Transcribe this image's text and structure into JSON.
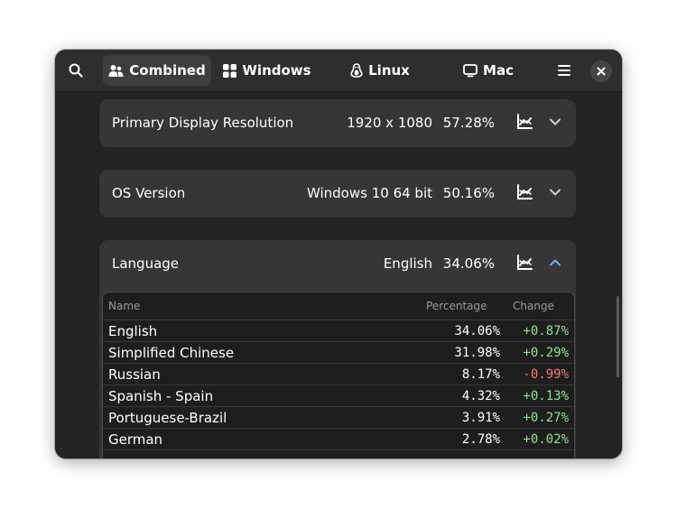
{
  "header": {
    "tabs": [
      {
        "label": "Combined",
        "icon": "users-icon",
        "active": true
      },
      {
        "label": "Windows",
        "icon": "windows-icon",
        "active": false
      },
      {
        "label": "Linux",
        "icon": "linux-icon",
        "active": false
      },
      {
        "label": "Mac",
        "icon": "monitor-icon",
        "active": false
      }
    ]
  },
  "rows": [
    {
      "label": "Primary Display Resolution",
      "value": "1920 x 1080",
      "pct": "57.28%",
      "expanded": false
    },
    {
      "label": "OS Version",
      "value": "Windows 10 64 bit",
      "pct": "50.16%",
      "expanded": false
    },
    {
      "label": "Language",
      "value": "English",
      "pct": "34.06%",
      "expanded": true
    }
  ],
  "language_table": {
    "columns": [
      "Name",
      "Percentage",
      "Change"
    ],
    "rows": [
      {
        "name": "English",
        "pct": "34.06%",
        "change": "+0.87%"
      },
      {
        "name": "Simplified Chinese",
        "pct": "31.98%",
        "change": "+0.29%"
      },
      {
        "name": "Russian",
        "pct": "8.17%",
        "change": "-0.99%"
      },
      {
        "name": "Spanish - Spain",
        "pct": "4.32%",
        "change": "+0.13%"
      },
      {
        "name": "Portuguese-Brazil",
        "pct": "3.91%",
        "change": "+0.27%"
      },
      {
        "name": "German",
        "pct": "2.78%",
        "change": "+0.02%"
      }
    ]
  },
  "colors": {
    "positive": "#8fe38b",
    "negative": "#f47a74",
    "accent": "#78aeed"
  }
}
